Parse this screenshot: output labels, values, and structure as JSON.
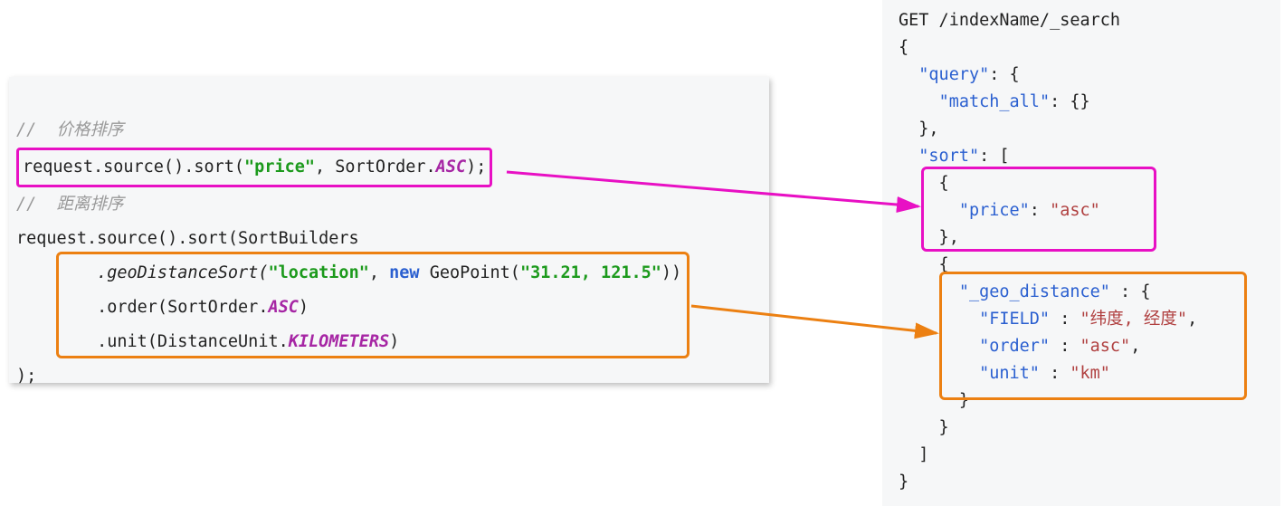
{
  "left": {
    "comment_price": "//  价格排序",
    "line_price_prefix": "request.source().sort(",
    "price_str": "\"price\"",
    "line_price_mid": ", SortOrder.",
    "asc": "ASC",
    "line_price_end": ");",
    "comment_dist": "//  距离排序",
    "line_geo1": "request.source().sort(SortBuilders",
    "geo_method": ".geoDistanceSort(",
    "location_str": "\"location\"",
    "geo_mid": ", ",
    "new_kw": "new",
    "geo_point": " GeoPoint(",
    "geo_coords": "\"31.21, 121.5\"",
    "geo_close": "))",
    "order_prefix": ".order(SortOrder.",
    "order_close": ")",
    "unit_prefix": ".unit(DistanceUnit.",
    "kilometers": "KILOMETERS",
    "unit_close": ")",
    "final": ");"
  },
  "right": {
    "l1": "GET /indexName/_search",
    "l2": "{",
    "query_key": "\"query\"",
    "match_all_key": "\"match_all\"",
    "sort_key": "\"sort\"",
    "price_key": "\"price\"",
    "price_val": "\"asc\"",
    "geo_key": "\"_geo_distance\"",
    "field_key": "\"FIELD\"",
    "field_val": "\"纬度, 经度\"",
    "order_key": "\"order\"",
    "order_val": "\"asc\"",
    "unit_key": "\"unit\"",
    "unit_val": "\"km\""
  }
}
